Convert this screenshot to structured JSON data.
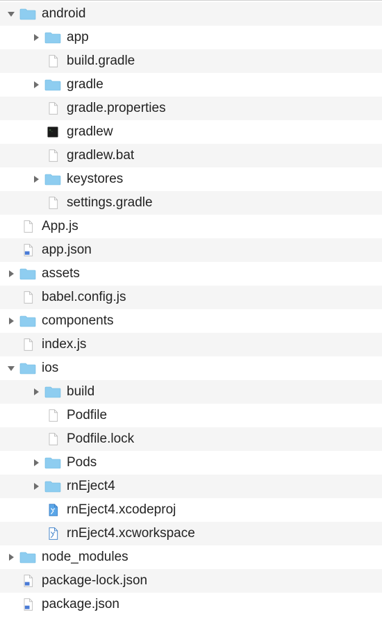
{
  "tree": [
    {
      "depth": 0,
      "disclosure": "down",
      "icon": "folder",
      "label": "android",
      "alt": true
    },
    {
      "depth": 1,
      "disclosure": "right",
      "icon": "folder",
      "label": "app",
      "alt": false
    },
    {
      "depth": 1,
      "disclosure": "none",
      "icon": "file",
      "label": "build.gradle",
      "alt": true
    },
    {
      "depth": 1,
      "disclosure": "right",
      "icon": "folder",
      "label": "gradle",
      "alt": false
    },
    {
      "depth": 1,
      "disclosure": "none",
      "icon": "file",
      "label": "gradle.properties",
      "alt": true
    },
    {
      "depth": 1,
      "disclosure": "none",
      "icon": "terminal",
      "label": "gradlew",
      "alt": false
    },
    {
      "depth": 1,
      "disclosure": "none",
      "icon": "file",
      "label": "gradlew.bat",
      "alt": true
    },
    {
      "depth": 1,
      "disclosure": "right",
      "icon": "folder",
      "label": "keystores",
      "alt": false
    },
    {
      "depth": 1,
      "disclosure": "none",
      "icon": "file",
      "label": "settings.gradle",
      "alt": true
    },
    {
      "depth": 0,
      "disclosure": "none",
      "icon": "file",
      "label": "App.js",
      "alt": false
    },
    {
      "depth": 0,
      "disclosure": "none",
      "icon": "json-file",
      "label": "app.json",
      "alt": true
    },
    {
      "depth": 0,
      "disclosure": "right",
      "icon": "folder",
      "label": "assets",
      "alt": false
    },
    {
      "depth": 0,
      "disclosure": "none",
      "icon": "file",
      "label": "babel.config.js",
      "alt": true
    },
    {
      "depth": 0,
      "disclosure": "right",
      "icon": "folder",
      "label": "components",
      "alt": false
    },
    {
      "depth": 0,
      "disclosure": "none",
      "icon": "file",
      "label": "index.js",
      "alt": true
    },
    {
      "depth": 0,
      "disclosure": "down",
      "icon": "folder",
      "label": "ios",
      "alt": false
    },
    {
      "depth": 1,
      "disclosure": "right",
      "icon": "folder",
      "label": "build",
      "alt": true
    },
    {
      "depth": 1,
      "disclosure": "none",
      "icon": "file",
      "label": "Podfile",
      "alt": false
    },
    {
      "depth": 1,
      "disclosure": "none",
      "icon": "file",
      "label": "Podfile.lock",
      "alt": true
    },
    {
      "depth": 1,
      "disclosure": "right",
      "icon": "folder",
      "label": "Pods",
      "alt": false
    },
    {
      "depth": 1,
      "disclosure": "right",
      "icon": "folder",
      "label": "rnEject4",
      "alt": true
    },
    {
      "depth": 1,
      "disclosure": "none",
      "icon": "xcodeproj",
      "label": "rnEject4.xcodeproj",
      "alt": false
    },
    {
      "depth": 1,
      "disclosure": "none",
      "icon": "xcworkspace",
      "label": "rnEject4.xcworkspace",
      "alt": true
    },
    {
      "depth": 0,
      "disclosure": "right",
      "icon": "folder",
      "label": "node_modules",
      "alt": false
    },
    {
      "depth": 0,
      "disclosure": "none",
      "icon": "json-file",
      "label": "package-lock.json",
      "alt": true
    },
    {
      "depth": 0,
      "disclosure": "none",
      "icon": "json-file",
      "label": "package.json",
      "alt": false
    }
  ],
  "colors": {
    "folder": "#8ecdf0",
    "folderStroke": "#6bb8e0",
    "triangle": "#6e6e6e",
    "fileFill": "#ffffff",
    "fileStroke": "#b8b8b8",
    "terminal": "#1a1a1a"
  }
}
